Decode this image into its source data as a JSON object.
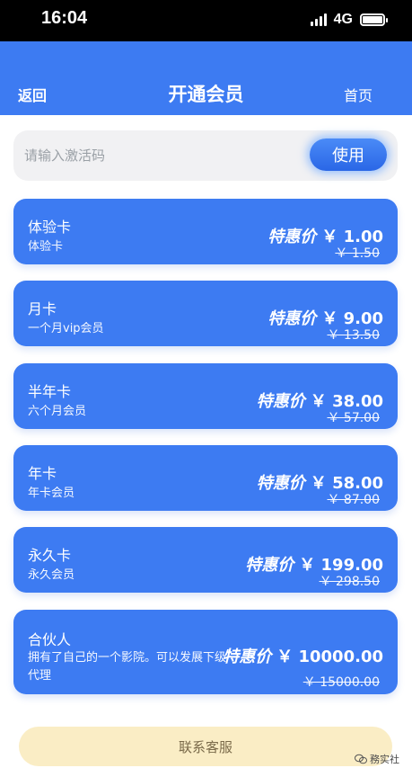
{
  "status_bar": {
    "time": "16:04",
    "network": "4G"
  },
  "header": {
    "back_label": "返回",
    "title": "开通会员",
    "home_label": "首页"
  },
  "activation": {
    "placeholder": "请输入激活码",
    "use_label": "使用"
  },
  "discount_label": "特惠价",
  "plans": [
    {
      "name": "体验卡",
      "desc": "体验卡",
      "price": "￥ 1.00",
      "original": "￥ 1.50"
    },
    {
      "name": "月卡",
      "desc": "一个月vip会员",
      "price": "￥ 9.00",
      "original": "￥ 13.50"
    },
    {
      "name": "半年卡",
      "desc": "六个月会员",
      "price": "￥ 38.00",
      "original": "￥ 57.00"
    },
    {
      "name": "年卡",
      "desc": "年卡会员",
      "price": "￥ 58.00",
      "original": "￥ 87.00"
    },
    {
      "name": "永久卡",
      "desc": "永久会员",
      "price": "￥ 199.00",
      "original": "￥ 298.50"
    },
    {
      "name": "合伙人",
      "desc": "拥有了自己的一个影院。可以发展下级代理",
      "price": "￥ 10000.00",
      "original": "￥ 15000.00"
    }
  ],
  "contact_label": "联系客服",
  "watermark": "務实社",
  "colors": {
    "primary": "#3d7bf2",
    "contact_bg": "#faedc5"
  }
}
